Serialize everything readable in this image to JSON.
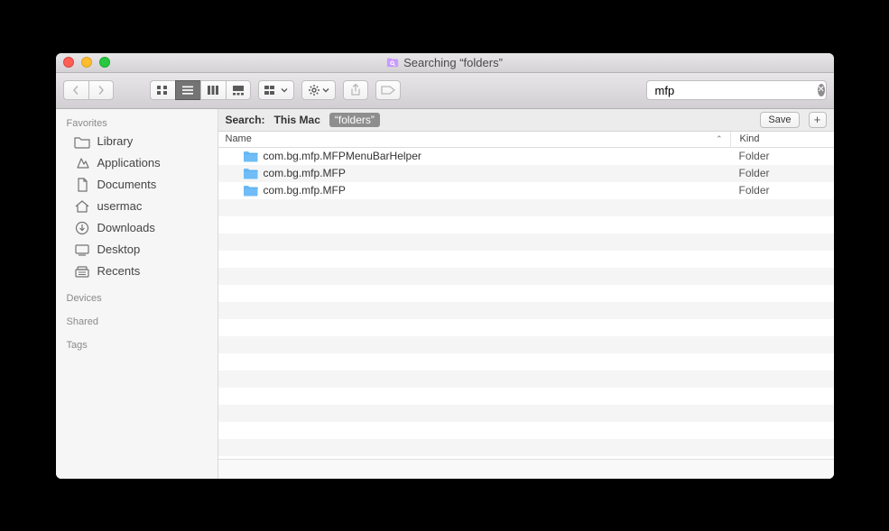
{
  "window": {
    "title": "Searching “folders”"
  },
  "search": {
    "query": "mfp"
  },
  "sidebar": {
    "sections": [
      {
        "header": "Favorites",
        "items": [
          {
            "icon": "folder",
            "label": "Library"
          },
          {
            "icon": "apps",
            "label": "Applications"
          },
          {
            "icon": "doc",
            "label": "Documents"
          },
          {
            "icon": "home",
            "label": "usermac"
          },
          {
            "icon": "download",
            "label": "Downloads"
          },
          {
            "icon": "desktop",
            "label": "Desktop"
          },
          {
            "icon": "recents",
            "label": "Recents"
          }
        ]
      },
      {
        "header": "Devices",
        "items": []
      },
      {
        "header": "Shared",
        "items": []
      },
      {
        "header": "Tags",
        "items": []
      }
    ]
  },
  "scope": {
    "label": "Search:",
    "thismac": "This Mac",
    "folder": "“folders”",
    "save": "Save"
  },
  "columns": {
    "name": "Name",
    "kind": "Kind"
  },
  "results": [
    {
      "name": "com.bg.mfp.MFPMenuBarHelper",
      "kind": "Folder"
    },
    {
      "name": "com.bg.mfp.MFP",
      "kind": "Folder"
    },
    {
      "name": "com.bg.mfp.MFP",
      "kind": "Folder"
    }
  ]
}
